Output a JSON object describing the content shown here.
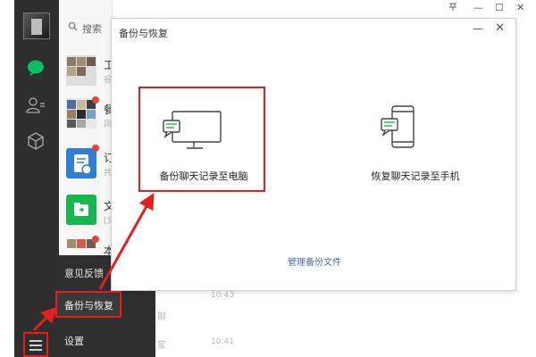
{
  "window": {
    "pin_icon": "pin-icon",
    "minimize_label": "—",
    "maximize_label": "☐",
    "close_label": "✕"
  },
  "search": {
    "label": "搜索"
  },
  "chats": [
    {
      "letter": "工",
      "sub": "谷"
    },
    {
      "letter": "餐",
      "sub": "风"
    },
    {
      "letter": "订",
      "sub": "共"
    },
    {
      "letter": "文",
      "sub": "[文"
    },
    {
      "letter": "本",
      "sub": ""
    }
  ],
  "menu": {
    "feedback": "意见反馈",
    "backup": "备份与恢复",
    "settings": "设置"
  },
  "dialog": {
    "title": "备份与恢复",
    "minimize": "—",
    "close": "✕",
    "backup_label": "备份聊天记录至电脑",
    "restore_label": "恢复聊天记录至手机",
    "manage_link": "管理备份文件"
  },
  "background": {
    "time1": "10:43",
    "time2": "10:41",
    "frag1": "聊",
    "frag2": "家"
  },
  "colors": {
    "accent_red": "#e1201f",
    "sidebar": "#2e2e2e",
    "wechat_green": "#07c160"
  }
}
